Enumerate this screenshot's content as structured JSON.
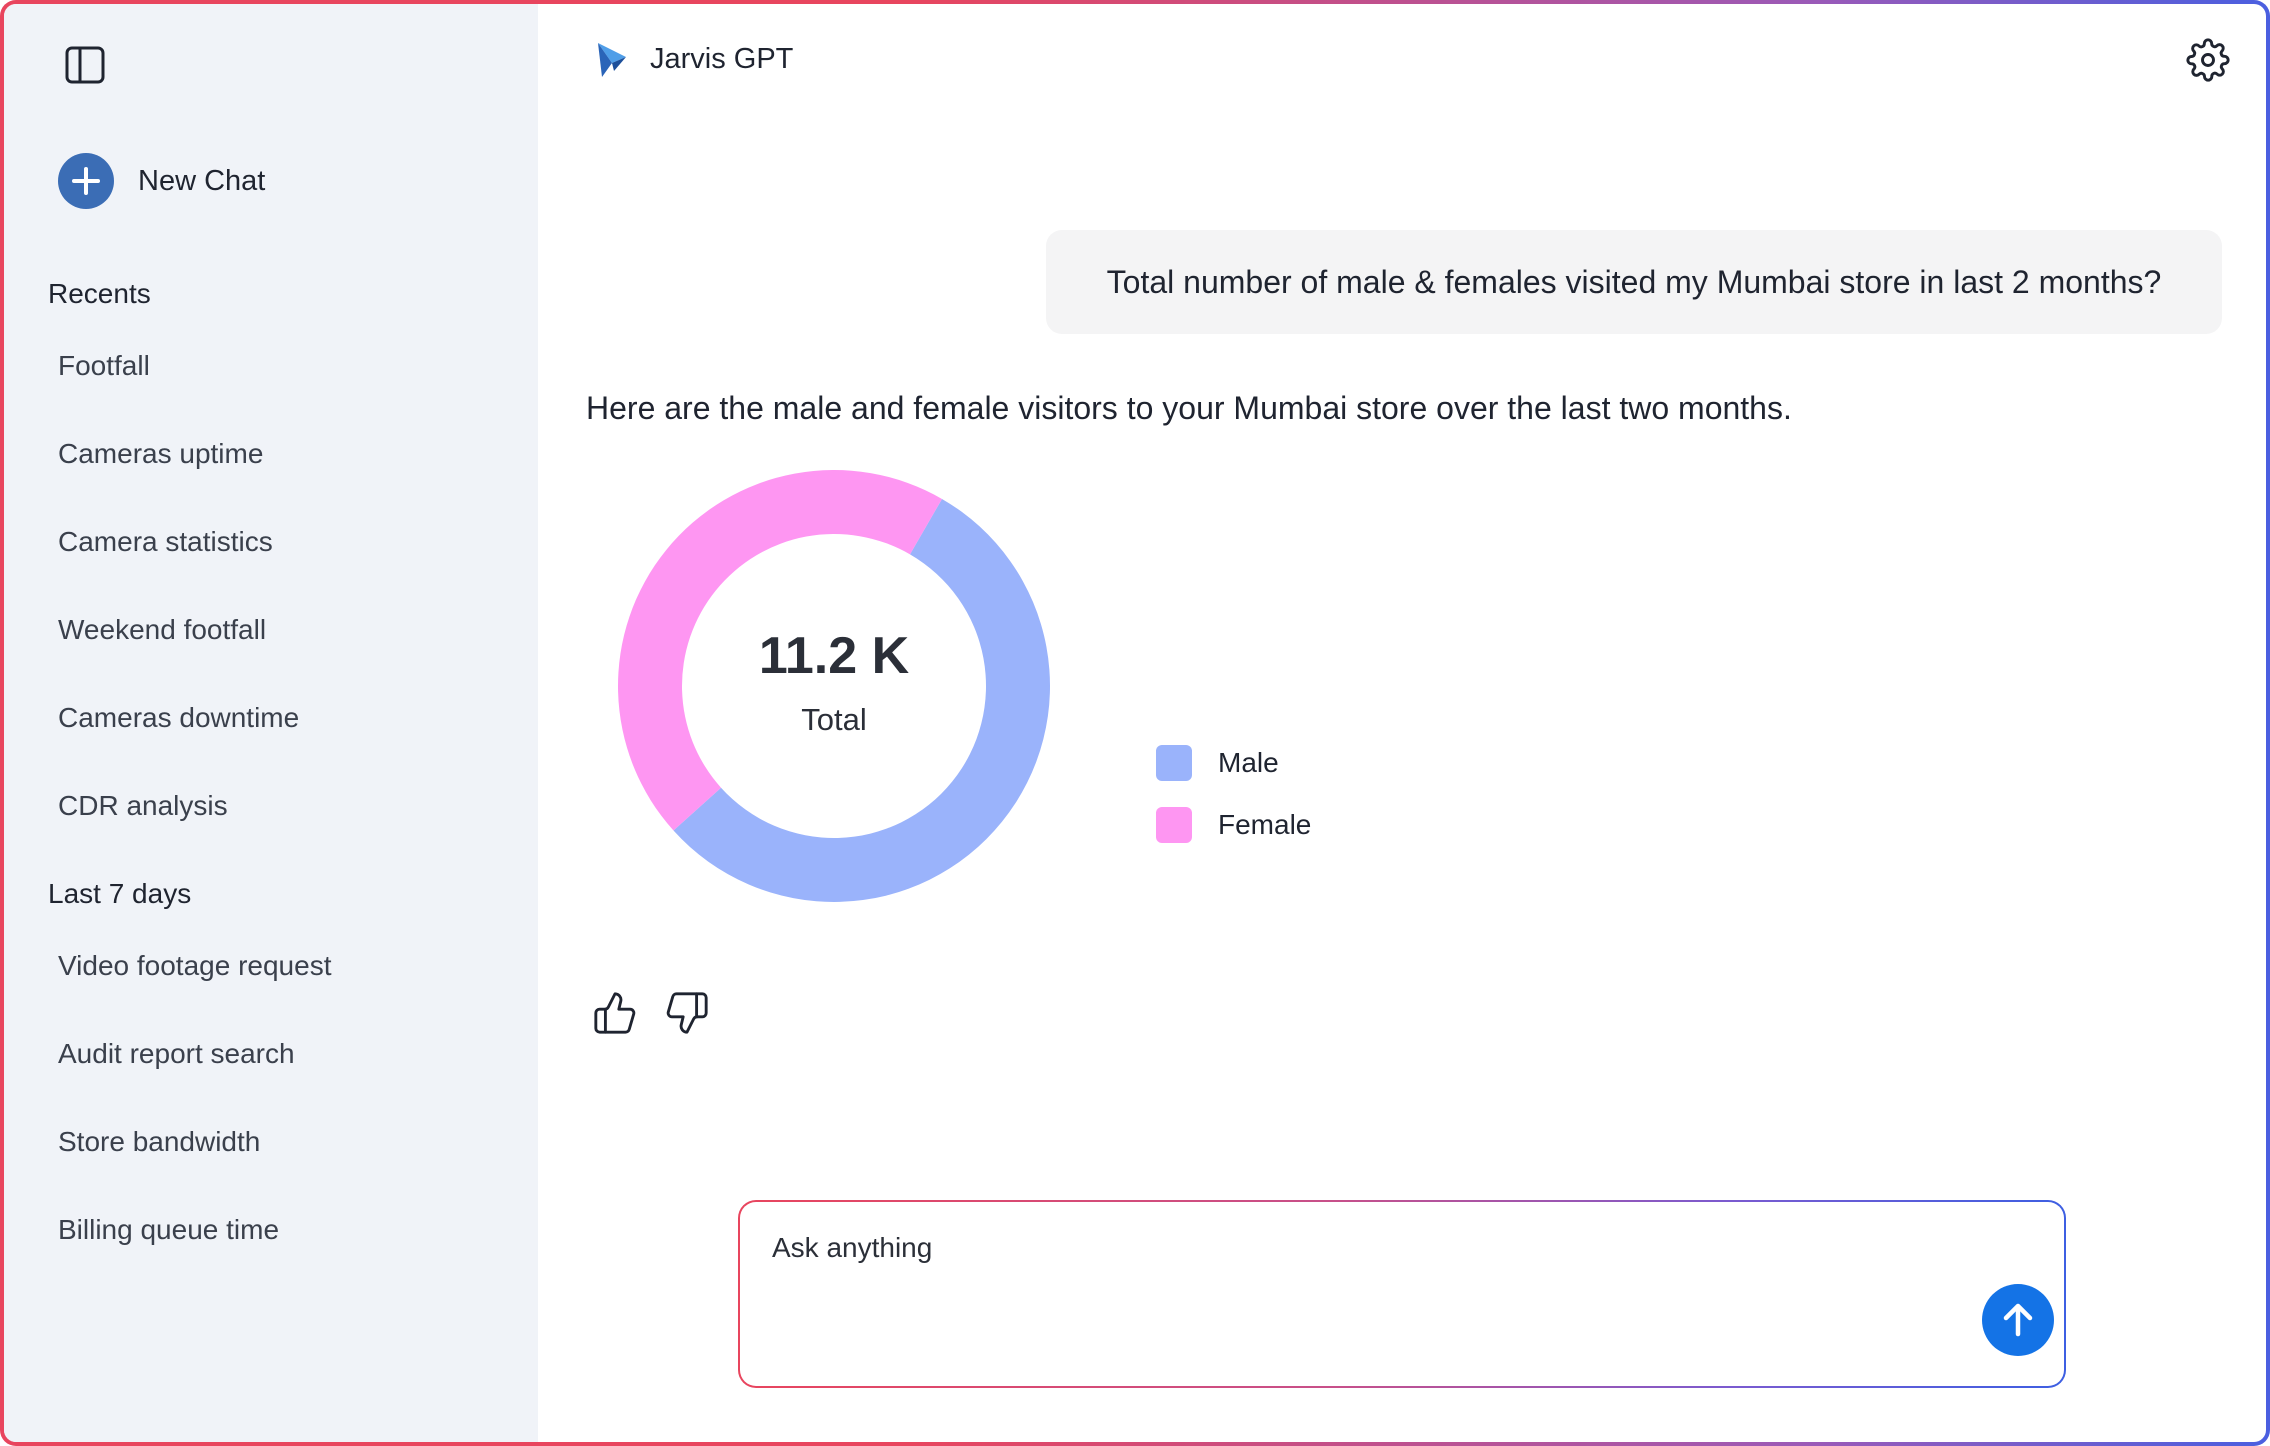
{
  "sidebar": {
    "new_chat_label": "New Chat",
    "recents_title": "Recents",
    "recents": [
      {
        "label": "Footfall"
      },
      {
        "label": "Cameras uptime"
      },
      {
        "label": "Camera statistics"
      },
      {
        "label": "Weekend footfall"
      },
      {
        "label": "Cameras downtime"
      },
      {
        "label": "CDR analysis"
      }
    ],
    "last7_title": "Last 7 days",
    "last7": [
      {
        "label": "Video footage request"
      },
      {
        "label": "Audit report search"
      },
      {
        "label": "Store bandwidth"
      },
      {
        "label": "Billing queue time"
      }
    ]
  },
  "header": {
    "app_name": "Jarvis GPT",
    "icons": [
      "sidebar-toggle-icon",
      "jarvis-logo-icon",
      "gear-icon"
    ]
  },
  "chat": {
    "user_message": "Total number of male & females visited my Mumbai store in last 2 months?",
    "assistant_message": "Here are the male and female visitors to your Mumbai store over the last two months.",
    "feedback_icons": [
      "thumbs-up-icon",
      "thumbs-down-icon"
    ]
  },
  "chart_data": {
    "type": "pie",
    "variant": "donut",
    "center_value": "11.2 K",
    "center_label": "Total",
    "categories": [
      "Male",
      "Female"
    ],
    "shares": [
      0.55,
      0.45
    ],
    "colors": [
      "#9ab3fb",
      "#fe96f2"
    ],
    "legend_position": "right"
  },
  "input": {
    "placeholder": "Ask anything",
    "send_icon": "arrow-up-icon"
  },
  "colors": {
    "sidebar_bg": "#f0f3f8",
    "accent_blue": "#1473e6",
    "new_chat_blue": "#3b6db5",
    "frame_gradient_start": "#e8455e",
    "frame_gradient_end": "#4a5fe0"
  }
}
